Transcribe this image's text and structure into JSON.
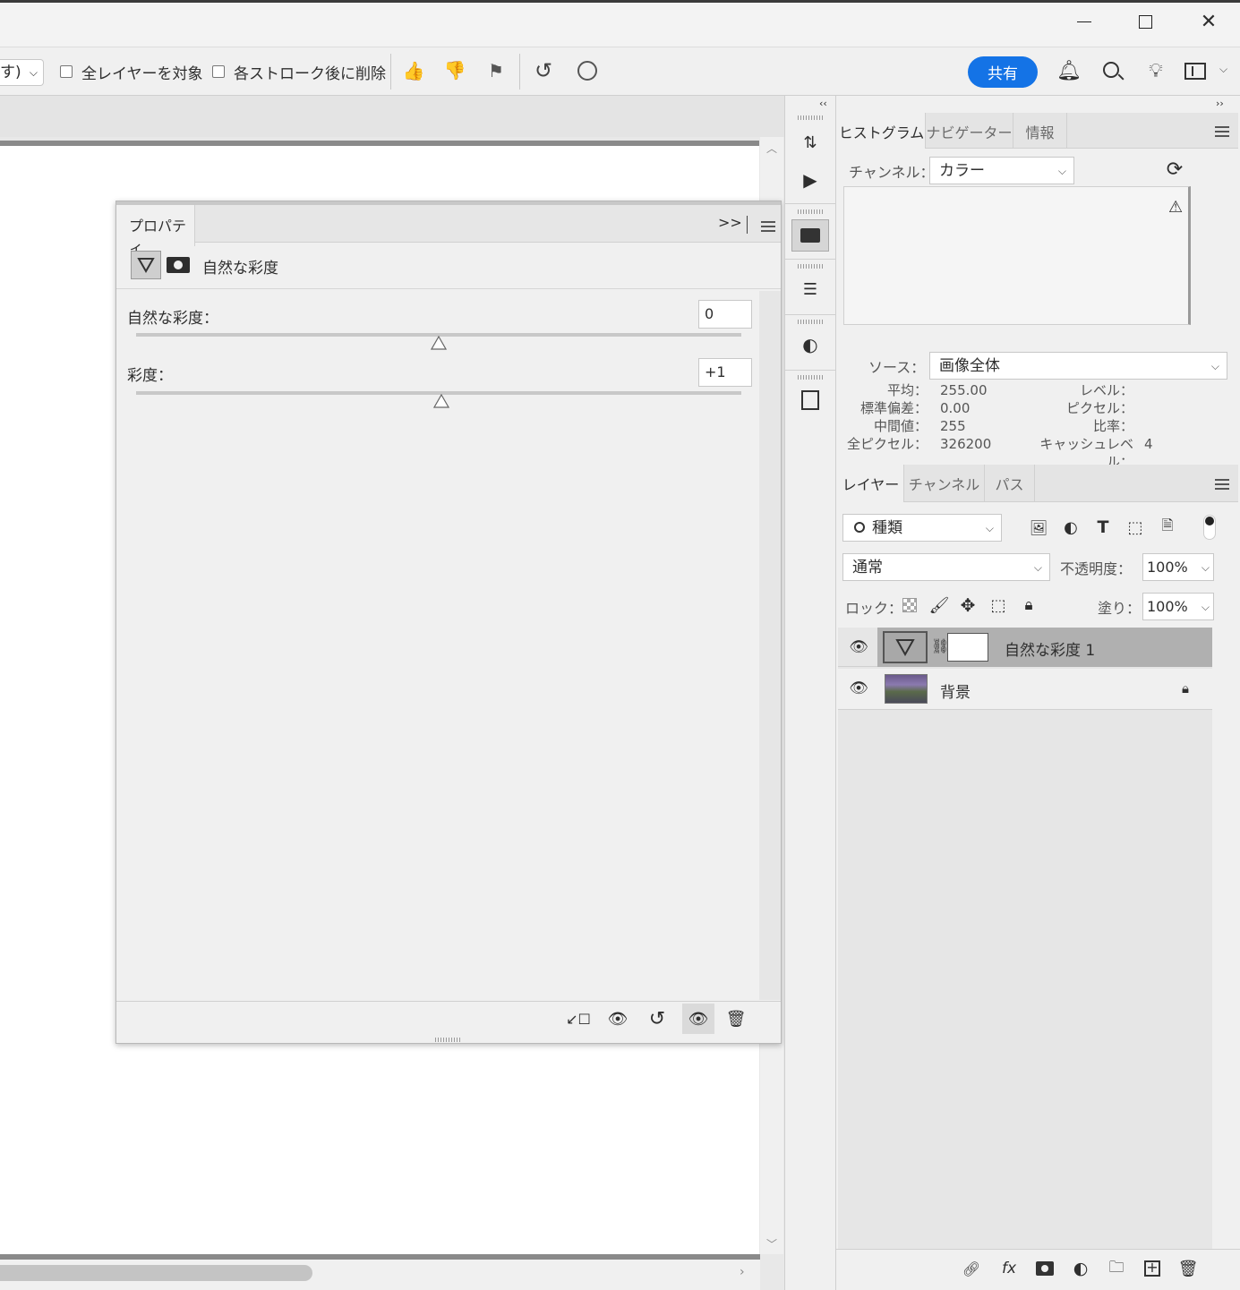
{
  "window": {
    "minimize": "—",
    "maximize": "☐",
    "close": "✕"
  },
  "options": {
    "mode_value": "す)",
    "all_layers_label": "全レイヤーを対象",
    "delete_after_label": "各ストローク後に削除",
    "share_label": "共有"
  },
  "properties": {
    "tab": "プロパティ",
    "title": "自然な彩度",
    "vibrance_label": "自然な彩度：",
    "vibrance_value": "0",
    "vibrance_level": 0,
    "saturation_label": "彩度：",
    "saturation_value": "+1",
    "saturation_level": 1
  },
  "histogram": {
    "tabs": [
      "ヒストグラム",
      "ナビゲーター",
      "情報"
    ],
    "channel_label": "チャンネル：",
    "channel_value": "カラー",
    "source_label": "ソース：",
    "source_value": "画像全体",
    "stats_left": [
      {
        "label": "平均：",
        "value": "255.00"
      },
      {
        "label": "標準偏差：",
        "value": "0.00"
      },
      {
        "label": "中間値：",
        "value": "255"
      },
      {
        "label": "全ピクセル：",
        "value": "326200"
      }
    ],
    "stats_right": [
      {
        "label": "レベル：",
        "value": ""
      },
      {
        "label": "ピクセル：",
        "value": ""
      },
      {
        "label": "比率：",
        "value": ""
      },
      {
        "label": "キャッシュレベル：",
        "value": "4"
      }
    ]
  },
  "layers": {
    "tabs": [
      "レイヤー",
      "チャンネル",
      "パス"
    ],
    "filter_value": "種類",
    "blend_mode": "通常",
    "opacity_label": "不透明度：",
    "opacity_value": "100%",
    "lock_label": "ロック：",
    "fill_label": "塗り：",
    "fill_value": "100%",
    "items": [
      {
        "name": "自然な彩度 1",
        "selected": true
      },
      {
        "name": "背景",
        "selected": false
      }
    ]
  },
  "colors": {
    "accent": "#1473e6",
    "selected_row": "#b0b0b0"
  }
}
